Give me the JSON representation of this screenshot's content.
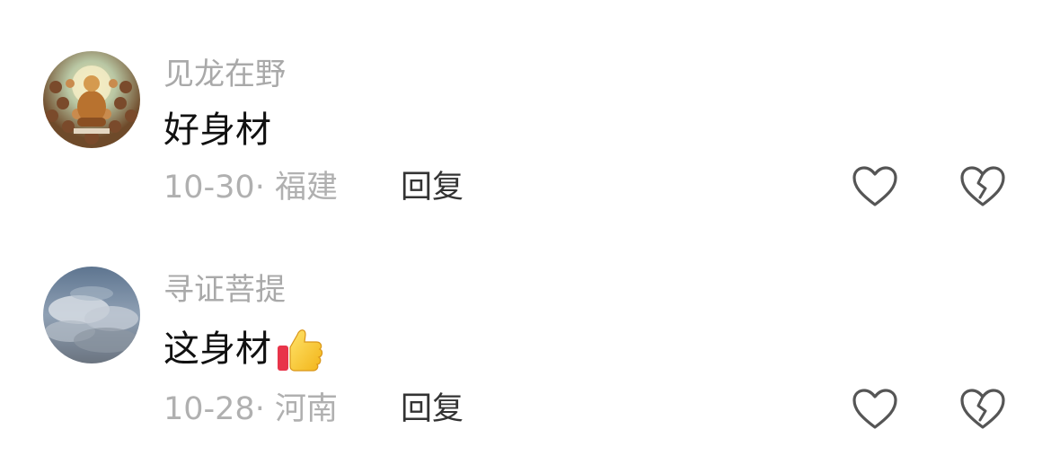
{
  "comments": [
    {
      "username": "见龙在野",
      "text": "好身材",
      "date": "10-30",
      "location": "福建",
      "reply_label": "回复",
      "avatar_icon": "buddha-painting-avatar"
    },
    {
      "username": "寻证菩提",
      "text": "这身材",
      "emoji": "thumbs-up-icon",
      "date": "10-28",
      "location": "河南",
      "reply_label": "回复",
      "avatar_icon": "cloudy-sky-avatar"
    }
  ],
  "meta_separator": "· ",
  "colors": {
    "username": "#a9a9a9",
    "text": "#111111",
    "meta": "#b0b0b0",
    "reply": "#333333",
    "icon_stroke": "#555555"
  }
}
